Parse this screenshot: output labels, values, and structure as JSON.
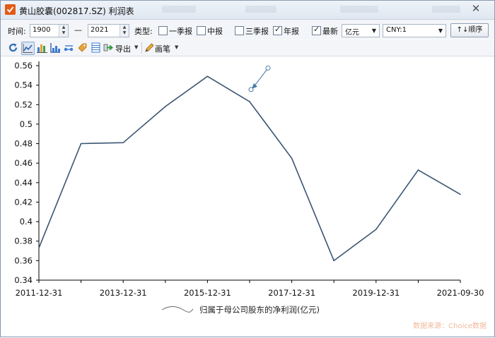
{
  "window": {
    "title": "黄山胶囊(002817.SZ) 利润表",
    "close_glyph": "✕",
    "accent_color": "#e55b13"
  },
  "filters": {
    "time_label": "时间:",
    "start_year": "1900",
    "separator": "—",
    "end_year": "2021",
    "type_label": "类型:",
    "q1_label": "一季报",
    "q1_checked": false,
    "semi_label": "中报",
    "semi_checked": false,
    "q3_label": "三季报",
    "q3_checked": false,
    "annual_label": "年报",
    "annual_checked": true,
    "latest_label": "最新",
    "latest_checked": true,
    "unit_value": "亿元",
    "currency_value": "CNY:1",
    "order_label": "↑↓顺序"
  },
  "toolbar": {
    "export_label": "导出",
    "pen_label": "画笔",
    "icons": [
      "refresh-icon",
      "line-chart-icon",
      "bar-chart-icon",
      "stacked-bar-chart-icon",
      "scatter-icon",
      "tag-icon",
      "table-icon",
      "export-icon",
      "pen-icon"
    ]
  },
  "chart_data": {
    "type": "line",
    "series": [
      {
        "name": "归属于母公司股东的净利润(亿元)",
        "color": "#3b5572",
        "x": [
          "2011-12-31",
          "2012-12-31",
          "2013-12-31",
          "2014-12-31",
          "2015-12-31",
          "2016-12-31",
          "2017-12-31",
          "2018-12-31",
          "2019-12-31",
          "2020-12-31",
          "2021-09-30"
        ],
        "values": [
          0.373,
          0.48,
          0.481,
          0.518,
          0.549,
          0.523,
          0.465,
          0.36,
          0.392,
          0.453,
          0.428
        ]
      }
    ],
    "xticks": [
      "2011-12-31",
      "2013-12-31",
      "2015-12-31",
      "2017-12-31",
      "2019-12-31",
      "2021-09-30"
    ],
    "yticks": [
      "0.34",
      "0.36",
      "0.38",
      "0.4",
      "0.42",
      "0.44",
      "0.46",
      "0.48",
      "0.5",
      "0.52",
      "0.54",
      "0.56"
    ],
    "ylim": [
      0.34,
      0.56
    ],
    "grid": false,
    "legend_position": "bottom-center",
    "annotation": "arrow",
    "annotation_color": "#4a7ba8",
    "source_note": "数据来源：Choice数据"
  }
}
